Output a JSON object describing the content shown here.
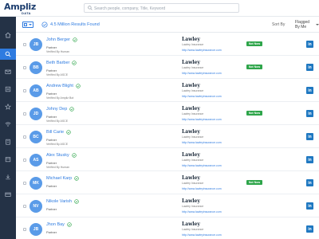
{
  "header": {
    "logo_text": "Ampliz",
    "logo_sub": "DATA",
    "search_placeholder": "Search people, company, Title, Keyword"
  },
  "sidebar": {
    "items": [
      {
        "icon": "home-icon",
        "active": false
      },
      {
        "icon": "search-icon",
        "active": true
      },
      {
        "icon": "mail-icon",
        "active": false
      },
      {
        "icon": "list-icon",
        "active": false
      },
      {
        "icon": "star-icon",
        "active": false
      },
      {
        "icon": "wifi-icon",
        "active": false
      },
      {
        "icon": "building-icon",
        "active": false
      },
      {
        "icon": "calendar-icon",
        "active": false
      },
      {
        "icon": "download-icon",
        "active": false
      },
      {
        "icon": "card-icon",
        "active": false
      }
    ]
  },
  "toolbar": {
    "results_text": "4.5 Million Results Found",
    "sort_label": "Sort By",
    "sort_value": "Flagged By Me"
  },
  "colors": {
    "accent": "#2e7be0",
    "sidebar": "#243246",
    "badge": "#2ea54a",
    "linkedin": "#1f78c1",
    "avatar": "#5a9be8"
  },
  "rows": [
    {
      "initials": "JB",
      "name": "John Berger",
      "title": "Partner",
      "verified": "Verified By Human",
      "company": "Lawley",
      "company_sub": "Lawley Insurance",
      "url": "http://www.lawleyinsurance.com",
      "badge": "Not Now",
      "linkedin": "in"
    },
    {
      "initials": "BB",
      "name": "Beth Barber",
      "title": "Partner",
      "verified": "Verified By ASCE",
      "company": "Lawley",
      "company_sub": "Lawley Insurance",
      "url": "http://www.lawleyinsurance.com",
      "badge": "Not Now",
      "linkedin": "in"
    },
    {
      "initials": "AB",
      "name": "Andrew Blight",
      "title": "Partner",
      "verified": "Verified By Ampliz Bot",
      "company": "Lawley",
      "company_sub": "Lawley Insurance",
      "url": "http://www.lawleyinsurance.com",
      "badge": "",
      "linkedin": "in"
    },
    {
      "initials": "JD",
      "name": "Johny Dep",
      "title": "Partner",
      "verified": "Verified By ASCE",
      "company": "Lawley",
      "company_sub": "Lawley Insurance",
      "url": "http://www.lawleyinsurance.com",
      "badge": "Not Now",
      "linkedin": "in"
    },
    {
      "initials": "BC",
      "name": "Bill Carie",
      "title": "Partner",
      "verified": "Verified By ASCE",
      "company": "Lawley",
      "company_sub": "Lawley Insurance",
      "url": "http://www.lawleyinsurance.com",
      "badge": "",
      "linkedin": "in"
    },
    {
      "initials": "AS",
      "name": "Alex Stusky",
      "title": "Partner",
      "verified": "Verified By Human",
      "company": "Lawley",
      "company_sub": "Lawley Insurance",
      "url": "http://www.lawleyinsurance.com",
      "badge": "",
      "linkedin": "in"
    },
    {
      "initials": "MK",
      "name": "Michael Karp",
      "title": "Partner",
      "verified": "",
      "company": "Lawley",
      "company_sub": "Lawley Insurance",
      "url": "http://www.lawleyinsurance.com",
      "badge": "Not Now",
      "linkedin": "in"
    },
    {
      "initials": "NV",
      "name": "Nikole Varish",
      "title": "Partner",
      "verified": "",
      "company": "Lawley",
      "company_sub": "Lawley Insurance",
      "url": "http://www.lawleyinsurance.com",
      "badge": "",
      "linkedin": "in"
    },
    {
      "initials": "JB",
      "name": "Jhon Bay",
      "title": "Partner",
      "verified": "",
      "company": "Lawley",
      "company_sub": "Lawley Insurance",
      "url": "http://www.lawleyinsurance.com",
      "badge": "",
      "linkedin": "in"
    }
  ]
}
